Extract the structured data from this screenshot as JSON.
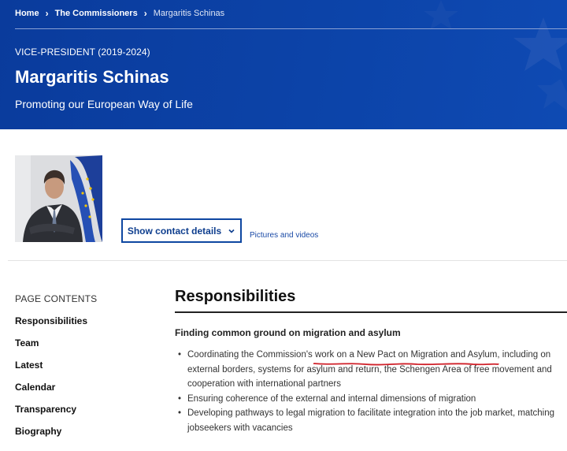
{
  "breadcrumb": {
    "items": [
      "Home",
      "The Commissioners",
      "Margaritis Schinas"
    ]
  },
  "hero": {
    "role": "VICE-PRESIDENT (2019-2024)",
    "name": "Margaritis Schinas",
    "portfolio": "Promoting our European Way of Life"
  },
  "profile": {
    "contact_button": "Show contact details",
    "contact_button_icon": "chevron-down-icon",
    "pictures_link": "Pictures and videos"
  },
  "toc": {
    "heading": "PAGE CONTENTS",
    "items": [
      "Responsibilities",
      "Team",
      "Latest",
      "Calendar",
      "Transparency",
      "Biography"
    ]
  },
  "main": {
    "title": "Responsibilities",
    "subheading": "Finding common ground on migration and asylum",
    "bullet1_pre": "Coordinating the Commission's ",
    "bullet1_mark": "work on a New Pact on Migration and Asylum",
    "bullet1_post": ", including on external borders, systems for asylum and return, the Schengen Area of free movement and cooperation with international partners",
    "bullet2": "Ensuring coherence of the external and internal dimensions of migration",
    "bullet3": "Developing pathways to legal migration to facilitate integration into the job market, matching jobseekers with vacancies"
  },
  "colors": {
    "hero_blue": "#0c43a8",
    "link_blue": "#1a4aa6",
    "annotation_red": "#d0212a"
  }
}
